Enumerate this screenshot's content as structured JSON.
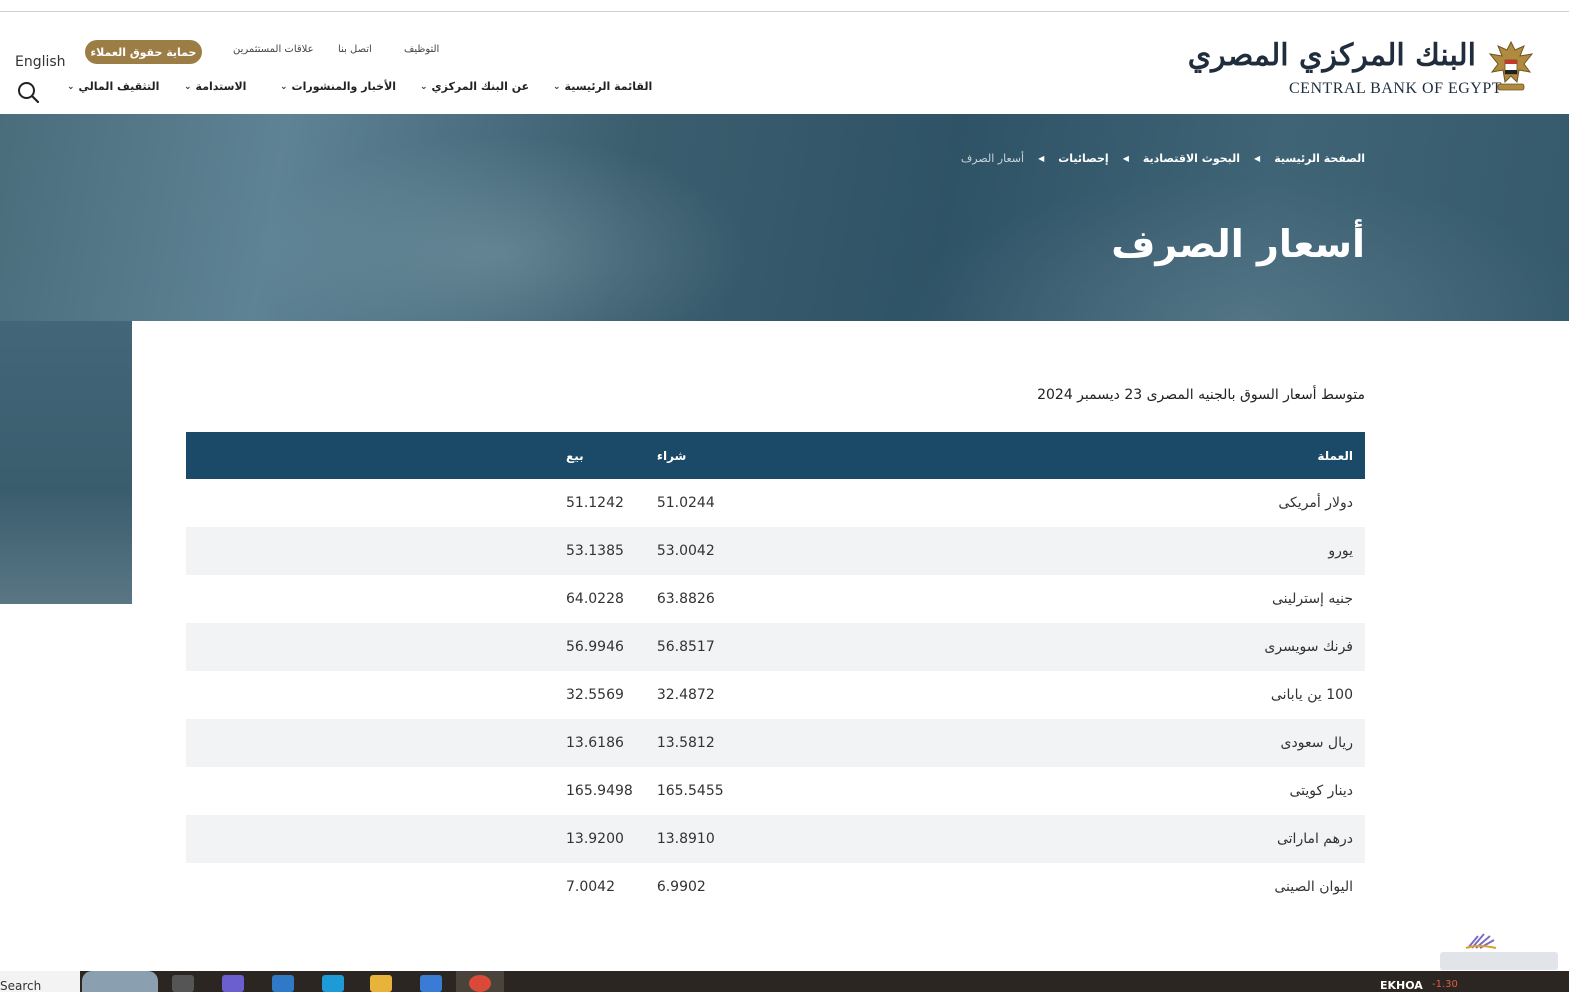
{
  "header": {
    "language_link": "English",
    "customer_rights_button": "حماية حقوق العملاء",
    "top_links": {
      "investor_relations": "علاقات المستثمرين",
      "contact_us": "اتصل بنا",
      "careers": "التوظيف"
    },
    "nav": {
      "main_menu": "القائمة الرئيسية",
      "about": "عن البنك المركزي",
      "news": "الأخبار والمنشورات",
      "sustainability": "الاستدامة",
      "financial_literacy": "التثقيف المالي"
    },
    "logo": {
      "arabic": "البنك المركزي المصري",
      "english": "CENTRAL BANK OF EGYPT"
    }
  },
  "breadcrumb": {
    "home": "الصفحة الرئيسية",
    "research": "البحوث الاقتصادية",
    "statistics": "إحصائيات",
    "current": "أسعار الصرف"
  },
  "page_title": "أسعار الصرف",
  "subtitle": "متوسط أسعار السوق بالجنيه المصرى 23 ديسمبر 2024",
  "table": {
    "headers": {
      "currency": "العملة",
      "buy": "شراء",
      "sell": "بيع"
    },
    "rows": [
      {
        "currency": "دولار أمريكى",
        "buy": "51.0244",
        "sell": "51.1242"
      },
      {
        "currency": "يورو",
        "buy": "53.0042",
        "sell": "53.1385"
      },
      {
        "currency": "جنيه إسترلينى",
        "buy": "63.8826",
        "sell": "64.0228"
      },
      {
        "currency": "فرنك سويسرى",
        "buy": "56.8517",
        "sell": "56.9946"
      },
      {
        "currency": "100 ين يابانى",
        "buy": "32.4872",
        "sell": "32.5569"
      },
      {
        "currency": "ريال سعودى",
        "buy": "13.5812",
        "sell": "13.6186"
      },
      {
        "currency": "دينار كويتى",
        "buy": "165.5455",
        "sell": "165.9498"
      },
      {
        "currency": "درهم اماراتى",
        "buy": "13.8910",
        "sell": "13.9200"
      },
      {
        "currency": "اليوان الصينى",
        "buy": "6.9902",
        "sell": "7.0042"
      }
    ]
  },
  "taskbar": {
    "search_text": "Search",
    "tray_label": "EKHOA",
    "tray_value": "-1.30"
  },
  "colors": {
    "brand_gold": "#9c7d45",
    "table_header": "#1a4a67",
    "hero": "#3b5e6f"
  }
}
